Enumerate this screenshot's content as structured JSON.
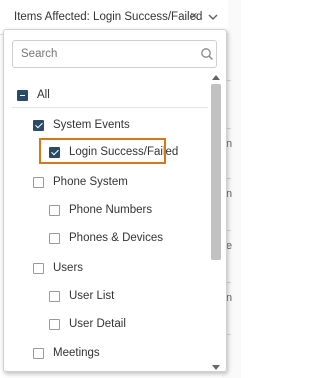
{
  "filter": {
    "label": "Items Affected: Login Success/Failed",
    "clear_glyph": "×"
  },
  "search": {
    "placeholder": "Search"
  },
  "tree": {
    "all": {
      "label": "All",
      "state": "partial"
    },
    "items": [
      {
        "label": "System Events",
        "state": "checked"
      },
      {
        "label": "Login Success/Failed",
        "state": "checked"
      },
      {
        "label": "Phone System",
        "state": "unchecked"
      },
      {
        "label": "Phone Numbers",
        "state": "unchecked"
      },
      {
        "label": "Phones & Devices",
        "state": "unchecked"
      },
      {
        "label": "Users",
        "state": "unchecked"
      },
      {
        "label": "User List",
        "state": "unchecked"
      },
      {
        "label": "User Detail",
        "state": "unchecked"
      },
      {
        "label": "Meetings",
        "state": "unchecked"
      }
    ]
  },
  "background_fragments": [
    "n",
    "n",
    "e",
    "n"
  ],
  "colors": {
    "checkbox_fill": "#2b4a66",
    "highlight_border": "#d07a1b",
    "scroll_thumb": "#c1c1c1"
  },
  "icons": {
    "search": "search-icon",
    "clear": "close-icon",
    "dropdown": "chevron-down-icon"
  }
}
